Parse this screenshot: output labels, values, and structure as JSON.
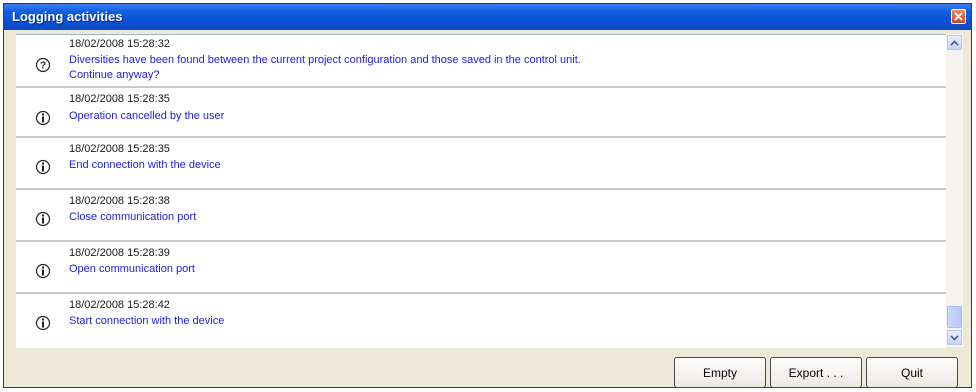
{
  "window": {
    "title": "Logging activities"
  },
  "log": {
    "entries": [
      {
        "timestamp": "18/02/2008 15:28:32",
        "message": "Diversities have been found between the current project configuration and those saved in the control unit.",
        "message2": "Continue anyway?",
        "icon": "question-icon"
      },
      {
        "timestamp": "18/02/2008 15:28:35",
        "message": "Operation cancelled by the user",
        "icon": "info-icon"
      },
      {
        "timestamp": "18/02/2008 15:28:35",
        "message": "End connection with the device",
        "icon": "info-icon"
      },
      {
        "timestamp": "18/02/2008 15:28:38",
        "message": "Close communication port",
        "icon": "info-icon"
      },
      {
        "timestamp": "18/02/2008 15:28:39",
        "message": "Open communication port",
        "icon": "info-icon"
      },
      {
        "timestamp": "18/02/2008 15:28:42",
        "message": "Start connection with the device",
        "icon": "info-icon"
      }
    ]
  },
  "buttons": {
    "empty": "Empty",
    "export": "Export . . .",
    "quit": "Quit"
  },
  "colors": {
    "titlebar": "#0a4fd0",
    "message_text": "#1e1edc",
    "dialog_bg": "#ece9d8"
  }
}
